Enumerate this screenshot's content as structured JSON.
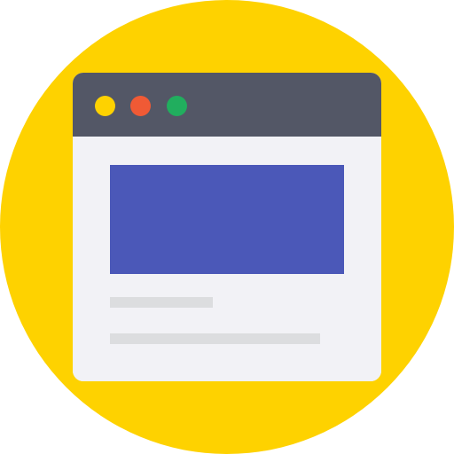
{
  "icon": {
    "name": "browser-window-icon",
    "colors": {
      "background_circle": "#FED200",
      "title_bar": "#535766",
      "window_body": "#F2F2F6",
      "dot_close": "#FED200",
      "dot_minimize": "#F05A35",
      "dot_maximize": "#21AE5E",
      "hero_block": "#4B58B8",
      "text_placeholder": "#DCDDDF"
    },
    "window_dots": [
      {
        "name": "yellow-dot",
        "color_key": "dot_close"
      },
      {
        "name": "red-dot",
        "color_key": "dot_minimize"
      },
      {
        "name": "green-dot",
        "color_key": "dot_maximize"
      }
    ]
  }
}
